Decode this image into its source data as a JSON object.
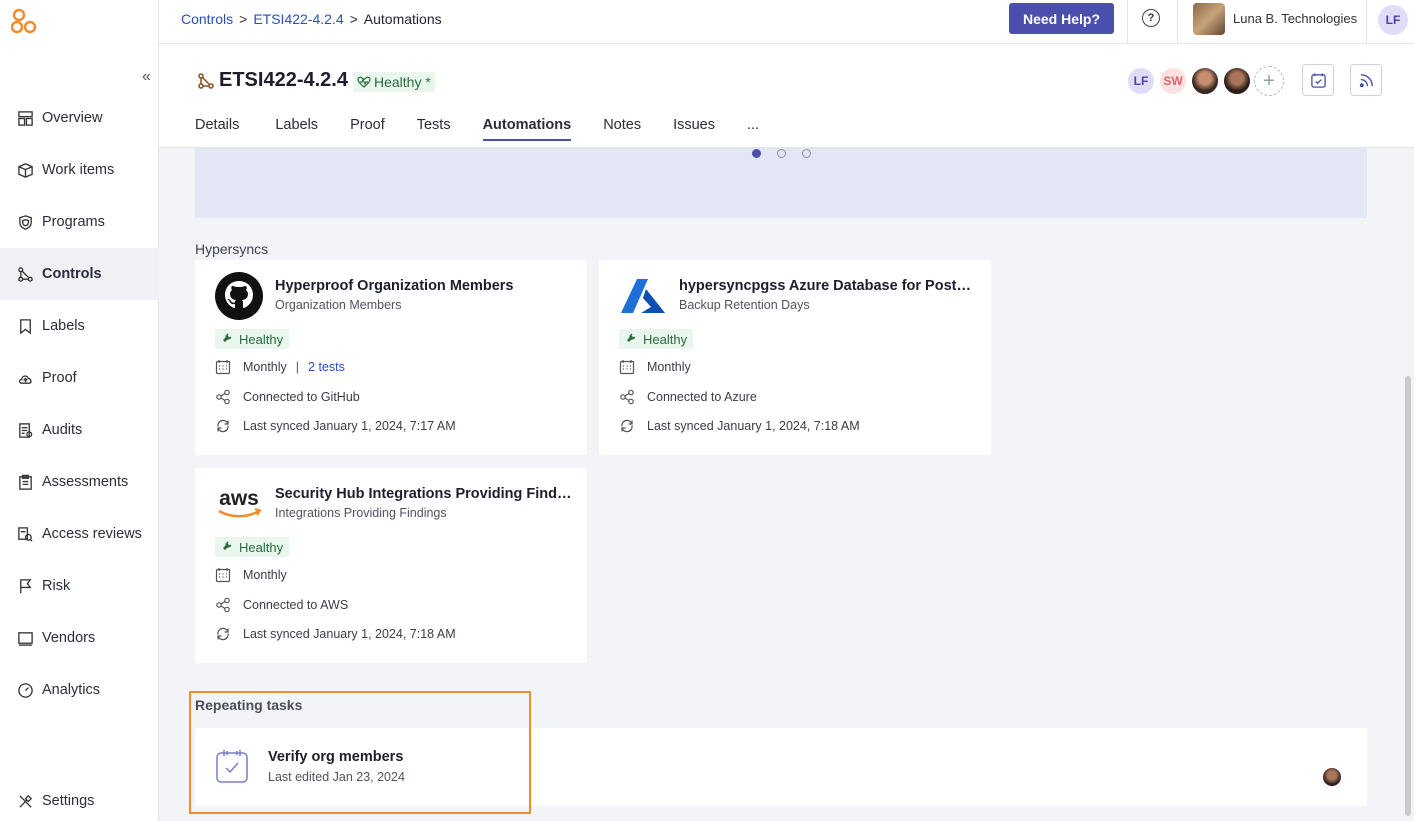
{
  "breadcrumb": {
    "root": "Controls",
    "parent": "ETSI422-4.2.4",
    "current": "Automations",
    "separator": ">"
  },
  "topbar": {
    "help_label": "Need Help?",
    "help_icon": "?",
    "org_name": "Luna B. Technologies",
    "user_initials": "LF"
  },
  "sidebar": {
    "collapse": "«",
    "items": [
      {
        "label": "Overview",
        "icon": "overview-icon"
      },
      {
        "label": "Work items",
        "icon": "box-icon"
      },
      {
        "label": "Programs",
        "icon": "shield-icon"
      },
      {
        "label": "Controls",
        "icon": "controls-icon",
        "active": true
      },
      {
        "label": "Labels",
        "icon": "bookmark-icon"
      },
      {
        "label": "Proof",
        "icon": "cloud-icon"
      },
      {
        "label": "Audits",
        "icon": "audit-icon"
      },
      {
        "label": "Assessments",
        "icon": "clipboard-icon"
      },
      {
        "label": "Access reviews",
        "icon": "access-icon"
      },
      {
        "label": "Risk",
        "icon": "flag-icon"
      },
      {
        "label": "Vendors",
        "icon": "vendor-icon"
      },
      {
        "label": "Analytics",
        "icon": "gauge-icon"
      }
    ],
    "settings": "Settings"
  },
  "header": {
    "title": "ETSI422-4.2.4",
    "health": "Healthy *",
    "collaborators": [
      "LF",
      "SW"
    ],
    "add": "+",
    "tabs": [
      "Details",
      "Labels",
      "Proof",
      "Tests",
      "Automations",
      "Notes",
      "Issues",
      "..."
    ],
    "active_tab": "Automations"
  },
  "colors": {
    "accent": "#4a4fae",
    "healthy_bg": "#e9f6ee",
    "healthy_text": "#2c6a3e",
    "highlight": "#f28c28",
    "link": "#2a4fb5"
  },
  "hypersyncs": {
    "label": "Hypersyncs",
    "cards": [
      {
        "name": "Hyperproof Organization Members",
        "sub": "Organization Members",
        "status": "Healthy",
        "frequency": "Monthly",
        "pipe": "|",
        "tests": "2 tests",
        "connected": "Connected to GitHub",
        "synced": "Last synced January 1, 2024, 7:17 AM",
        "logo": "github-logo"
      },
      {
        "name": "hypersyncpgss Azure Database for PostgreSQL",
        "sub": "Backup Retention Days",
        "status": "Healthy",
        "frequency": "Monthly",
        "connected": "Connected to Azure",
        "synced": "Last synced January 1, 2024, 7:18 AM",
        "logo": "azure-logo"
      },
      {
        "name": "Security Hub Integrations Providing Findings",
        "sub": "Integrations Providing Findings",
        "status": "Healthy",
        "frequency": "Monthly",
        "connected": "Connected to AWS",
        "synced": "Last synced January 1, 2024, 7:18 AM",
        "logo": "aws-logo",
        "logo_text": "aws"
      }
    ]
  },
  "repeating": {
    "label": "Repeating tasks",
    "task": {
      "name": "Verify org members",
      "sub": "Last edited Jan 23, 2024"
    }
  }
}
